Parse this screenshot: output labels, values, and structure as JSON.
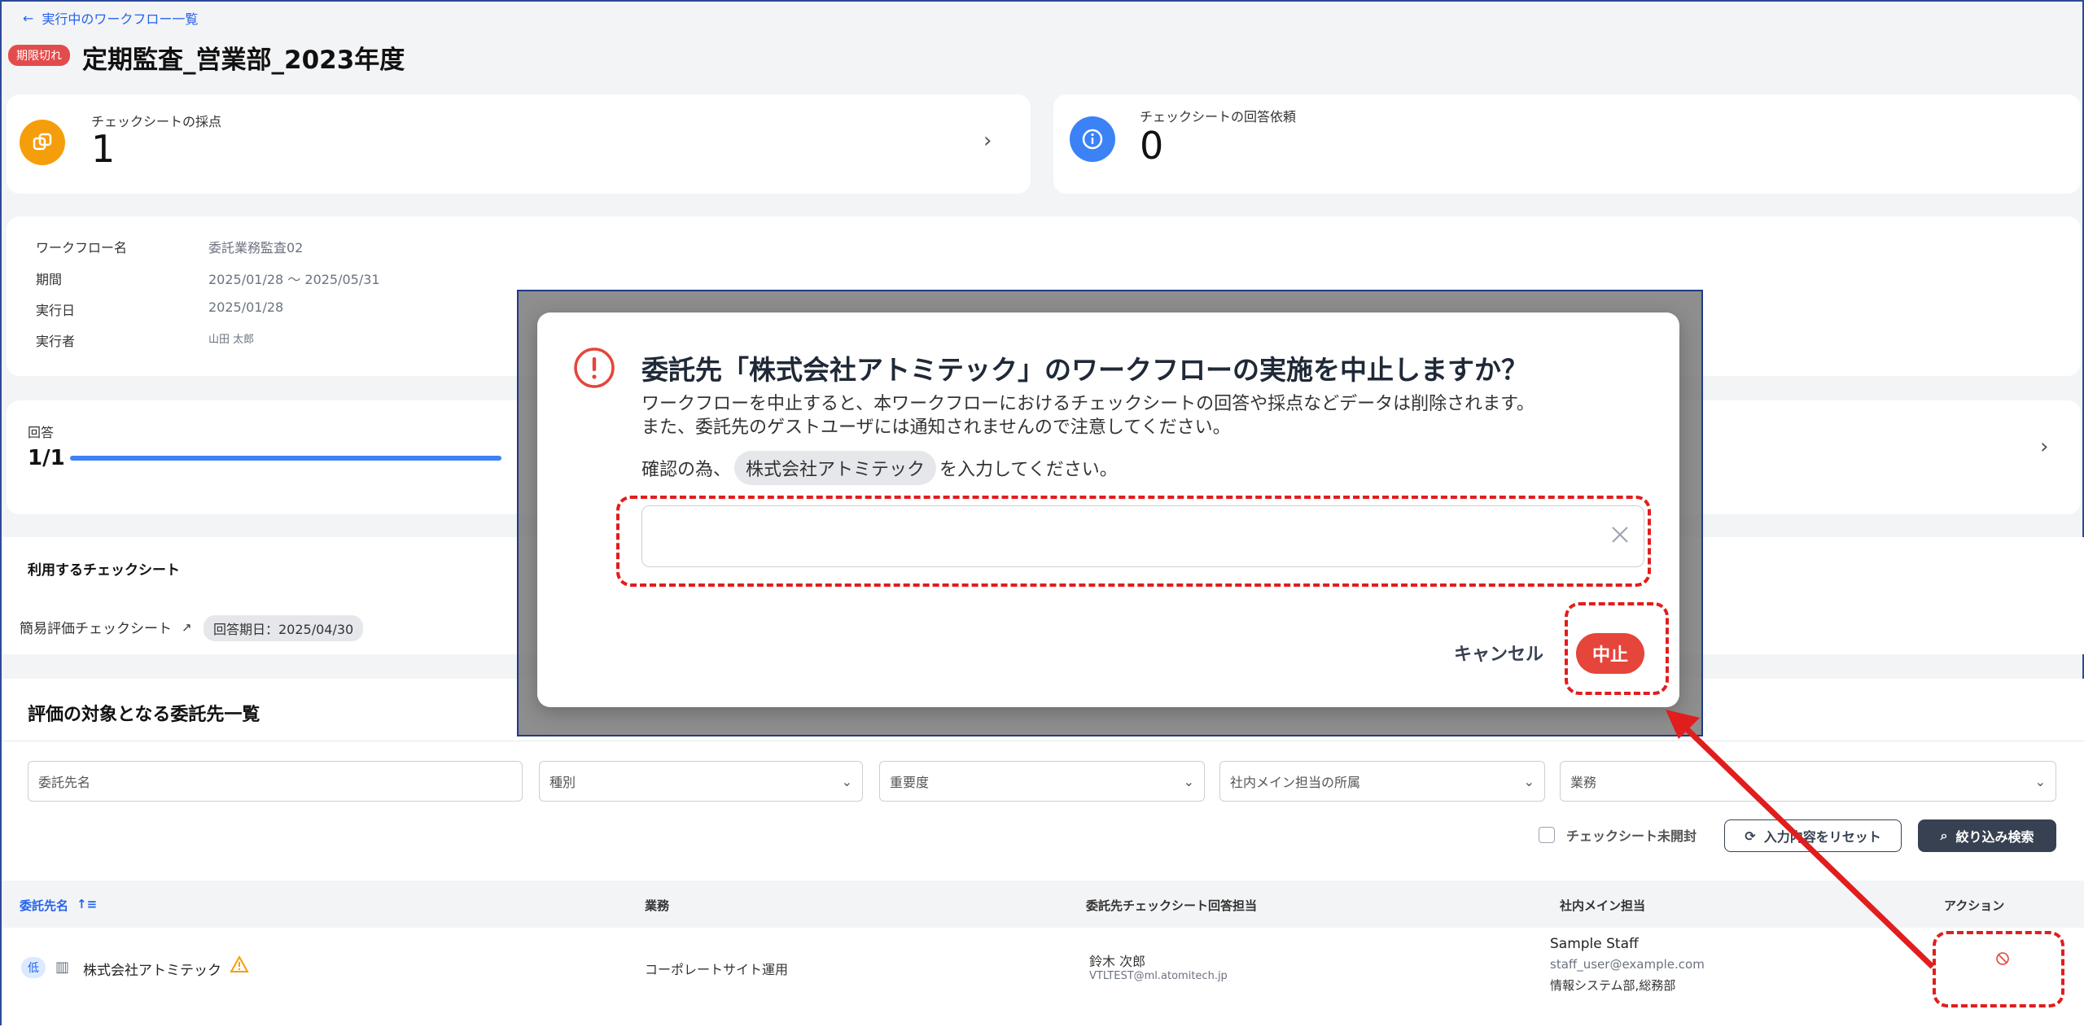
{
  "header": {
    "back_label": "実行中のワークフロー一覧",
    "status_badge": "期限切れ",
    "title": "定期監査_営業部_2023年度"
  },
  "stats": {
    "scoring_label": "チェックシートの採点",
    "scoring_value": "1",
    "request_label": "チェックシートの回答依頼",
    "request_value": "0"
  },
  "info": {
    "rows": [
      {
        "label": "ワークフロー名",
        "value": "委託業務監査02"
      },
      {
        "label": "期間",
        "value": "2025/01/28 〜 2025/05/31"
      },
      {
        "label": "実行日",
        "value": "2025/01/28"
      },
      {
        "label": "実行者",
        "value": "山田 太郎"
      }
    ]
  },
  "answers": {
    "label": "回答",
    "count": "1/1",
    "progress": 1.0
  },
  "checksheet": {
    "section_title": "利用するチェックシート",
    "name": "簡易評価チェックシート",
    "due": "回答期日：2025/04/30"
  },
  "targets": {
    "section_title": "評価の対象となる委託先一覧",
    "filters": {
      "name_placeholder": "委託先名",
      "type": "種別",
      "importance": "重要度",
      "dept": "社内メイン担当の所属",
      "business": "業務"
    },
    "unopened_label": "チェックシート未開封",
    "reset_label": "入力内容をリセット",
    "search_label": "絞り込み検索",
    "columns": [
      "委託先名",
      "業務",
      "委託先チェックシート回答担当",
      "社内メイン担当",
      "アクション"
    ],
    "rows": [
      {
        "level": "低",
        "name": "株式会社アトミテック",
        "business": "コーポレートサイト運用",
        "responder_name": "鈴木 次郎",
        "responder_email": "VTLTEST@ml.atomitech.jp",
        "staff_name": "Sample Staff",
        "staff_email": "staff_user@example.com",
        "staff_dept": "情報システム部,総務部"
      }
    ]
  },
  "modal": {
    "title": "委託先「株式会社アトミテック」のワークフローの実施を中止しますか？",
    "body_line1": "ワークフローを中止すると、本ワークフローにおけるチェックシートの回答や採点などデータは削除されます。",
    "body_line2": "また、委託先のゲストユーザには通知されませんので注意してください。",
    "confirm_prefix": "確認の為、",
    "confirm_chip": "株式会社アトミテック",
    "confirm_suffix": "を入力してください。",
    "input_value": "",
    "cancel_label": "キャンセル",
    "stop_label": "中止"
  },
  "colors": {
    "accent": "#2563eb",
    "danger": "#e5453b",
    "annotation": "#e11d1d",
    "scoring_icon": "#f59e0b",
    "request_icon": "#3b82f6"
  }
}
